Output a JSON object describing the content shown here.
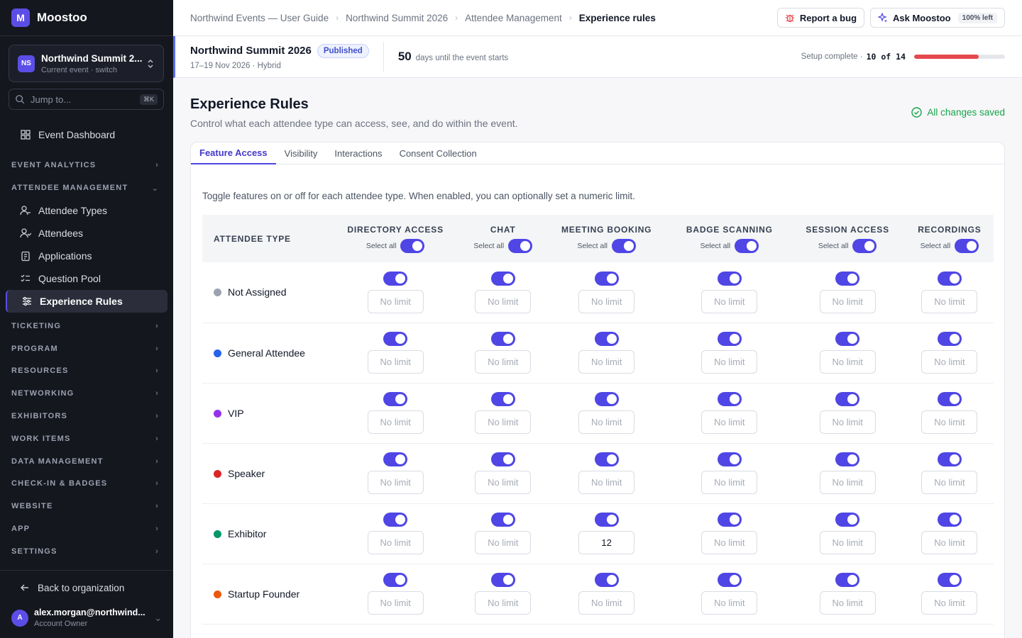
{
  "app": {
    "logo_letter": "M",
    "name": "Moostoo"
  },
  "event_switcher": {
    "badge": "NS",
    "name": "Northwind Summit 2...",
    "sub": "Current event · switch"
  },
  "jump": {
    "placeholder": "Jump to...",
    "shortcut": "⌘K"
  },
  "sidebar": {
    "dashboard": "Event Dashboard",
    "event_analytics": "EVENT ANALYTICS",
    "attendee_management": "ATTENDEE MANAGEMENT",
    "items": [
      "Attendee Types",
      "Attendees",
      "Applications",
      "Question Pool",
      "Experience Rules"
    ],
    "sections": [
      "TICKETING",
      "PROGRAM",
      "RESOURCES",
      "NETWORKING",
      "EXHIBITORS",
      "WORK ITEMS",
      "DATA MANAGEMENT",
      "CHECK-IN & BADGES",
      "WEBSITE",
      "APP",
      "SETTINGS"
    ],
    "back": "Back to organization",
    "user_initial": "A",
    "user_email": "alex.morgan@northwind...",
    "user_role": "Account Owner"
  },
  "breadcrumbs": [
    "Northwind Events — User Guide",
    "Northwind Summit 2026",
    "Attendee Management",
    "Experience rules"
  ],
  "topbar": {
    "report": "Report a bug",
    "ask": "Ask Moostoo",
    "ask_pill": "100% left"
  },
  "event": {
    "name": "Northwind Summit 2026",
    "status": "Published",
    "dates": "17–19 Nov 2026 · Hybrid",
    "days": "50",
    "days_text": "days until the event starts",
    "setup_label": "Setup complete ·",
    "setup_count": "10 of 14",
    "setup_progress": 0.714
  },
  "page": {
    "title": "Experience Rules",
    "subtitle": "Control what each attendee type can access, see, and do within the event.",
    "saved": "All changes saved"
  },
  "tabs": [
    "Feature Access",
    "Visibility",
    "Interactions",
    "Consent Collection"
  ],
  "help": "Toggle features on or off for each attendee type. When enabled, you can optionally set a numeric limit.",
  "table": {
    "type_header": "ATTENDEE TYPE",
    "select_all": "Select all",
    "limit_placeholder": "No limit",
    "columns": [
      "DIRECTORY ACCESS",
      "CHAT",
      "MEETING BOOKING",
      "BADGE SCANNING",
      "SESSION ACCESS",
      "RECORDINGS"
    ],
    "rows": [
      {
        "name": "Not Assigned",
        "color": "#9ca3af",
        "limits": [
          "",
          "",
          "",
          "",
          "",
          ""
        ]
      },
      {
        "name": "General Attendee",
        "color": "#2563eb",
        "limits": [
          "",
          "",
          "",
          "",
          "",
          ""
        ]
      },
      {
        "name": "VIP",
        "color": "#9333ea",
        "limits": [
          "",
          "",
          "",
          "",
          "",
          ""
        ]
      },
      {
        "name": "Speaker",
        "color": "#dc2626",
        "limits": [
          "",
          "",
          "",
          "",
          "",
          ""
        ]
      },
      {
        "name": "Exhibitor",
        "color": "#059669",
        "limits": [
          "",
          "",
          "12",
          "",
          "",
          ""
        ]
      },
      {
        "name": "Startup Founder",
        "color": "#ea580c",
        "limits": [
          "",
          "",
          "",
          "",
          "",
          ""
        ]
      }
    ]
  }
}
